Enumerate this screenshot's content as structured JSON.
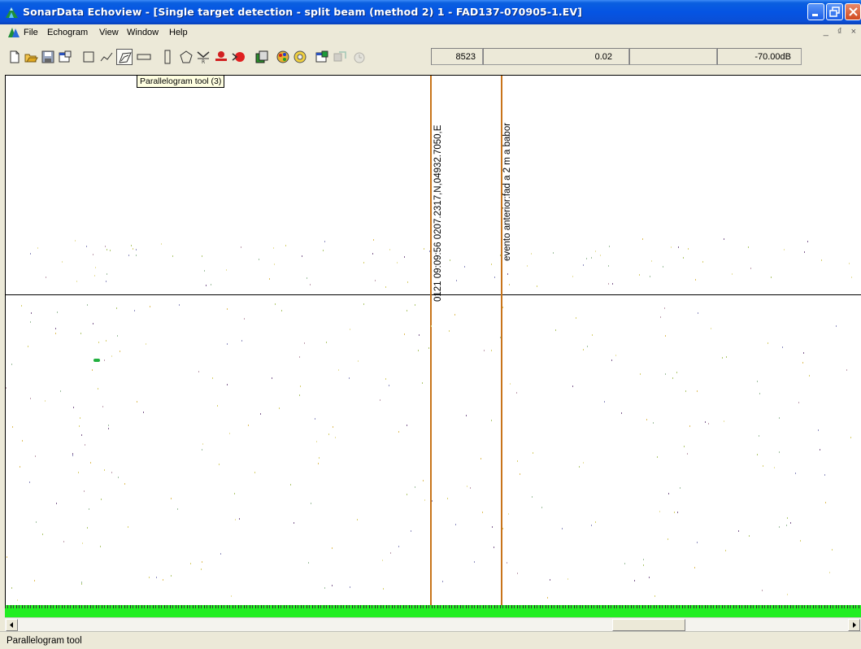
{
  "window": {
    "title": "SonarData Echoview - [Single target detection - split beam (method 2) 1 - FAD137-070905-1.EV]",
    "controls": [
      "minimize",
      "restore",
      "close"
    ]
  },
  "menu": {
    "items": [
      "File",
      "Echogram",
      "View",
      "Window",
      "Help"
    ],
    "mdi_controls": "_ ₫ ×"
  },
  "toolbar": {
    "buttons": [
      "new-icon",
      "open-icon",
      "save-icon",
      "properties-icon",
      "rectangle-tool-icon",
      "polyline-tool-icon",
      "parallelogram-tool-icon",
      "horizontal-band-tool-icon",
      "vertical-band-tool-icon",
      "polygon-tool-icon",
      "bottom-pick-icon",
      "line-pick-icon",
      "school-detect-icon",
      "layers-icon",
      "colors-icon",
      "settings-icon",
      "variable-properties-icon",
      "export-icon",
      "timer-icon"
    ],
    "readouts": {
      "ping": "8523",
      "value": "0.02",
      "threshold": "-70.00dB"
    }
  },
  "tooltip": {
    "text": "Parallelogram tool (3)"
  },
  "echogram": {
    "line_label_1": "0121 09:09:56 0207.2317,N,04932.7050,E",
    "line_label_2": "evento anterior:fad a 2 m a babor"
  },
  "status": {
    "text": "Parallelogram tool"
  },
  "colors": {
    "region_line": "#c8741a",
    "bottom_band": "#22ee22",
    "titlebar": "#0554e3"
  }
}
